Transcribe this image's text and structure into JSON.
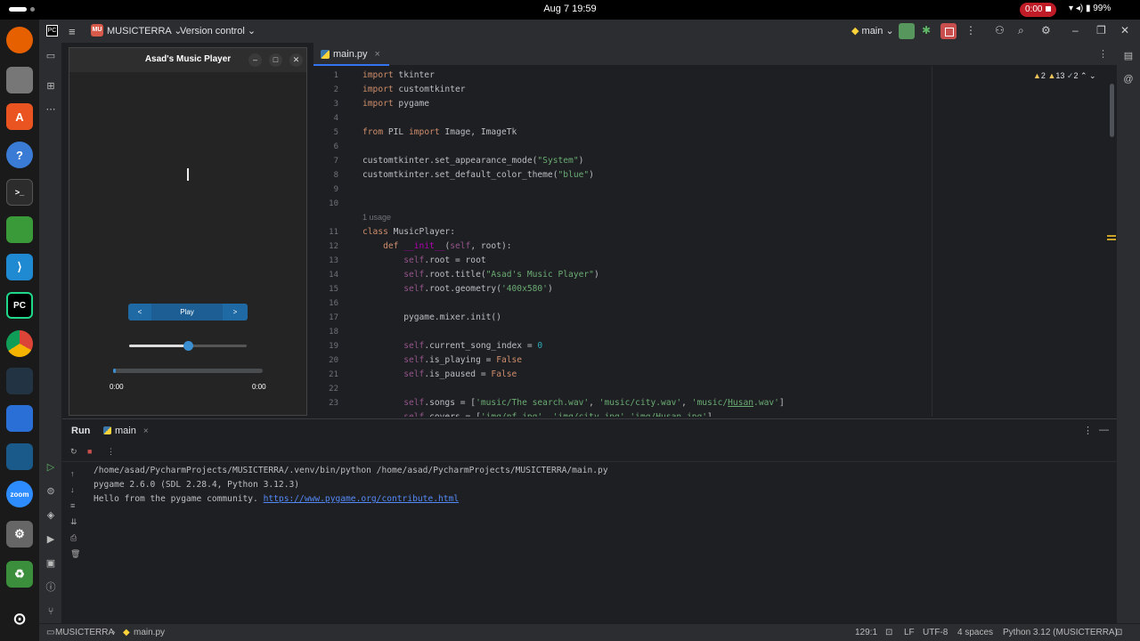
{
  "system_bar": {
    "clock": "Aug 7  19:59",
    "recording": "0:00",
    "battery": "99%"
  },
  "ide": {
    "project_name": "MUSICTERRA",
    "project_badge": "MU",
    "vcs_label": "Version control",
    "branch": "main"
  },
  "editor": {
    "tab": "main.py",
    "inspection": {
      "warnings": "2",
      "weak_warnings": "13",
      "typos": "2"
    },
    "usage_hint": "1 usage"
  },
  "app_window": {
    "title": "Asad's Music Player",
    "prev_label": "<",
    "play_label": "Play",
    "next_label": ">",
    "volume_fraction": 0.5,
    "progress_fraction": 0.0,
    "time_elapsed": "0:00",
    "time_total": "0:00"
  },
  "run_panel": {
    "title": "Run",
    "config": "main",
    "output": [
      "/home/asad/PycharmProjects/MUSICTERRA/.venv/bin/python /home/asad/PycharmProjects/MUSICTERRA/main.py",
      "pygame 2.6.0 (SDL 2.28.4, Python 3.12.3)",
      "Hello from the pygame community. "
    ],
    "link": "https://www.pygame.org/contribute.html"
  },
  "status_bar": {
    "project": "MUSICTERRA",
    "file": "main.py",
    "position": "129:1",
    "line_sep": "LF",
    "encoding": "UTF-8",
    "indent": "4 spaces",
    "interpreter": "Python 3.12 (MUSICTERRA)"
  }
}
